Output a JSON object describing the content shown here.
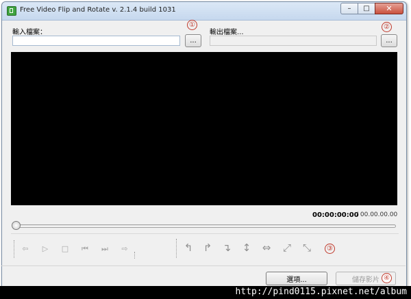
{
  "window": {
    "title": "Free Video Flip and Rotate  v. 2.1.4 build 1031",
    "minimize_glyph": "–",
    "maximize_glyph": "□",
    "close_glyph": "✕"
  },
  "input": {
    "label": "輸入檔案：",
    "value": "",
    "browse_label": "..."
  },
  "output": {
    "label": "輸出檔案...",
    "value": "",
    "browse_label": "..."
  },
  "markers": [
    "①",
    "②",
    "③",
    "④"
  ],
  "player": {
    "current_time": "00:00:00:00",
    "total_time": "/ 00.00.00.00",
    "position_fraction": 0
  },
  "playback_controls": [
    {
      "icon": "step-back-icon",
      "glyph": "⇦"
    },
    {
      "icon": "play-icon",
      "glyph": "▷"
    },
    {
      "icon": "stop-icon",
      "glyph": "□"
    },
    {
      "icon": "previous-frame-icon",
      "glyph": "⏮"
    },
    {
      "icon": "next-frame-icon",
      "glyph": "⏭"
    },
    {
      "icon": "step-forward-icon",
      "glyph": "⇨"
    }
  ],
  "transform_tools": [
    {
      "icon": "rotate-left-icon",
      "glyph": "↰"
    },
    {
      "icon": "rotate-right-icon",
      "glyph": "↱"
    },
    {
      "icon": "rotate-180-icon",
      "glyph": "↴"
    },
    {
      "icon": "flip-vertical-icon",
      "glyph": "↕"
    },
    {
      "icon": "flip-horizontal-icon",
      "glyph": "⇔"
    },
    {
      "icon": "transpose-icon",
      "glyph": "⤢"
    },
    {
      "icon": "transverse-icon",
      "glyph": "⤡"
    }
  ],
  "buttons": {
    "options_label": "選項...",
    "save_label": "儲存影片"
  },
  "watermark": "http://pind0115.pixnet.net/album"
}
